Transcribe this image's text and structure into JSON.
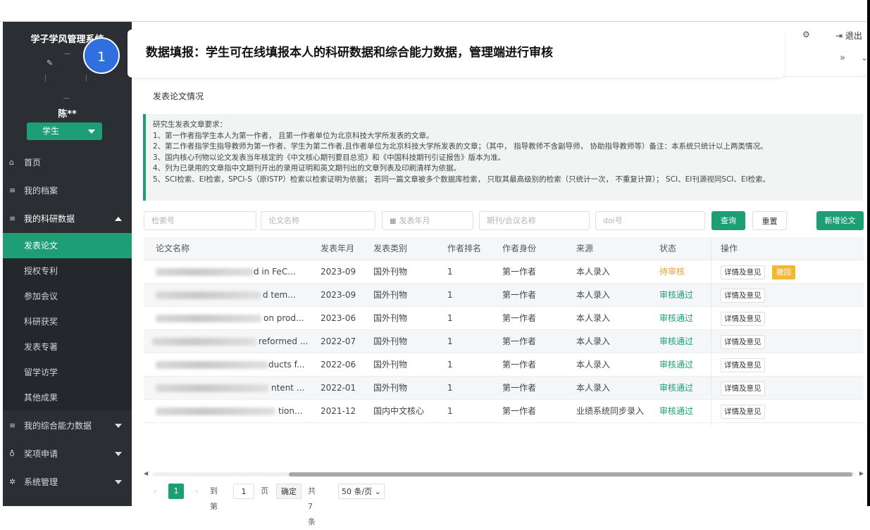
{
  "sidebar": {
    "app_title": "学子学风管理系统",
    "user_name": "陈**",
    "role": "学生",
    "menu": {
      "home": "首页",
      "archive": "我的档案",
      "research": "我的科研数据",
      "ability": "我的综合能力数据",
      "awards": "奖项申请",
      "system": "系统管理"
    },
    "submenu": [
      "发表论文",
      "授权专利",
      "参加会议",
      "科研获奖",
      "发表专著",
      "留学访学",
      "其他成果"
    ]
  },
  "header": {
    "logout": "退出",
    "callout_number": "1",
    "callout_text": "数据填报：学生可在线填报本人的科研数据和综合能力数据，管理端进行审核"
  },
  "page": {
    "breadcrumb": "发表论文情况",
    "notice": [
      "研究生发表文章要求：",
      "1、第一作者指学生本人为第一作者， 且第一作者单位为北京科技大学所发表的文章。",
      "2、第二作者指学生指导教师为第一作者、学生为第二作者,且作者单位为北京科技大学所发表的文章；（其中， 指导教师不含副导师， 协助指导教师等）备注：本系统只统计以上两类情况。",
      "3、国内核心刊物以论文发表当年核定的《中文核心期刊要目总览》和《中国科技期刊引证报告》版本为准。",
      "4、列为已录用的文章指中文期刊开出的录用证明和英文期刊出的文章列表及印刷清样为依据。",
      "5、SCI检索、EI检索，SPCI-S（原ISTP）检索以检索证明为依据； 若同一篇文章被多个数据库检索， 只取其最高级别的检索（只统计一次， 不重复计算）； SCI、EI刊源视同SCI、EI检索。"
    ]
  },
  "filters": {
    "search_number": "检索号",
    "paper_name": "论文名称",
    "publish_month": "发表年月",
    "journal": "期刊/会议名称",
    "doi": "doi号",
    "query": "查询",
    "reset": "重置",
    "add": "新增论文"
  },
  "table": {
    "headers": [
      "论文名称",
      "发表年月",
      "发表类别",
      "作者排名",
      "作者身份",
      "来源",
      "状态",
      "操作"
    ],
    "rows": [
      {
        "name": "d in FeC...",
        "date": "2023-09",
        "category": "国外刊物",
        "rank": "1",
        "role": "第一作者",
        "source": "本人录入",
        "status": "待审核",
        "status_type": "pending",
        "op": "详情及意见",
        "withdraw": "撤回"
      },
      {
        "name": "d tem...",
        "date": "2023-09",
        "category": "国外刊物",
        "rank": "1",
        "role": "第一作者",
        "source": "本人录入",
        "status": "审核通过",
        "status_type": "ok",
        "op": "详情及意见"
      },
      {
        "name": "on prod...",
        "date": "2023-06",
        "category": "国外刊物",
        "rank": "1",
        "role": "第一作者",
        "source": "本人录入",
        "status": "审核通过",
        "status_type": "ok",
        "op": "详情及意见"
      },
      {
        "name": "reformed ...",
        "date": "2022-07",
        "category": "国外刊物",
        "rank": "1",
        "role": "第一作者",
        "source": "本人录入",
        "status": "审核通过",
        "status_type": "ok",
        "op": "详情及意见"
      },
      {
        "name": "ducts f...",
        "date": "2022-06",
        "category": "国外刊物",
        "rank": "1",
        "role": "第一作者",
        "source": "本人录入",
        "status": "审核通过",
        "status_type": "ok",
        "op": "详情及意见"
      },
      {
        "name": "ntent ...",
        "date": "2022-01",
        "category": "国外刊物",
        "rank": "1",
        "role": "第一作者",
        "source": "本人录入",
        "status": "审核通过",
        "status_type": "ok",
        "op": "详情及意见"
      },
      {
        "name": "tion...",
        "date": "2021-12",
        "category": "国内中文核心",
        "rank": "1",
        "role": "第一作者",
        "source": "业绩系统同步录入",
        "status": "审核通过",
        "status_type": "ok",
        "op": "详情及意见"
      }
    ]
  },
  "pagination": {
    "current": "1",
    "goto_prefix": "到第",
    "goto_value": "1",
    "page_unit": "页",
    "confirm": "确定",
    "total": "共 7 条",
    "page_size": "50 条/页"
  }
}
